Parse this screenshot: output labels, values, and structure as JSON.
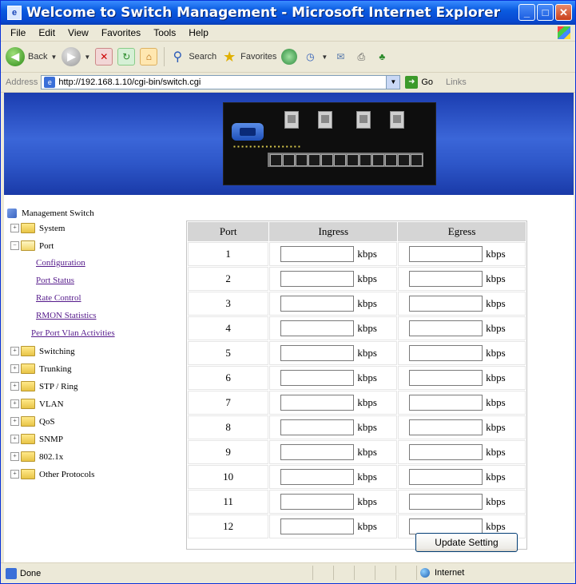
{
  "window": {
    "title": "Welcome to Switch Management - Microsoft Internet Explorer",
    "minimize": "_",
    "maximize": "□",
    "close": "✕"
  },
  "menubar": [
    "File",
    "Edit",
    "View",
    "Favorites",
    "Tools",
    "Help"
  ],
  "toolbar": {
    "back": "Back",
    "search": "Search",
    "favorites": "Favorites"
  },
  "address": {
    "label": "Address",
    "url": "http://192.168.1.10/cgi-bin/switch.cgi",
    "go": "Go",
    "links": "Links"
  },
  "tree": {
    "root": "Management Switch",
    "items": [
      {
        "label": "System",
        "type": "folder"
      },
      {
        "label": "Port",
        "type": "folder-open"
      },
      {
        "label": "Configuration",
        "type": "link"
      },
      {
        "label": "Port Status",
        "type": "link"
      },
      {
        "label": "Rate Control",
        "type": "link"
      },
      {
        "label": "RMON Statistics",
        "type": "link"
      },
      {
        "label": "Per Port Vlan Activities",
        "type": "link"
      },
      {
        "label": "Switching",
        "type": "folder"
      },
      {
        "label": "Trunking",
        "type": "folder"
      },
      {
        "label": "STP / Ring",
        "type": "folder"
      },
      {
        "label": "VLAN",
        "type": "folder"
      },
      {
        "label": "QoS",
        "type": "folder"
      },
      {
        "label": "SNMP",
        "type": "folder"
      },
      {
        "label": "802.1x",
        "type": "folder"
      },
      {
        "label": "Other Protocols",
        "type": "folder"
      }
    ]
  },
  "rate_table": {
    "headers": [
      "Port",
      "Ingress",
      "Egress"
    ],
    "unit": "kbps",
    "ports": [
      "1",
      "2",
      "3",
      "4",
      "5",
      "6",
      "7",
      "8",
      "9",
      "10",
      "11",
      "12"
    ],
    "update_button": "Update Setting"
  },
  "status": {
    "text": "Done",
    "zone": "Internet"
  }
}
